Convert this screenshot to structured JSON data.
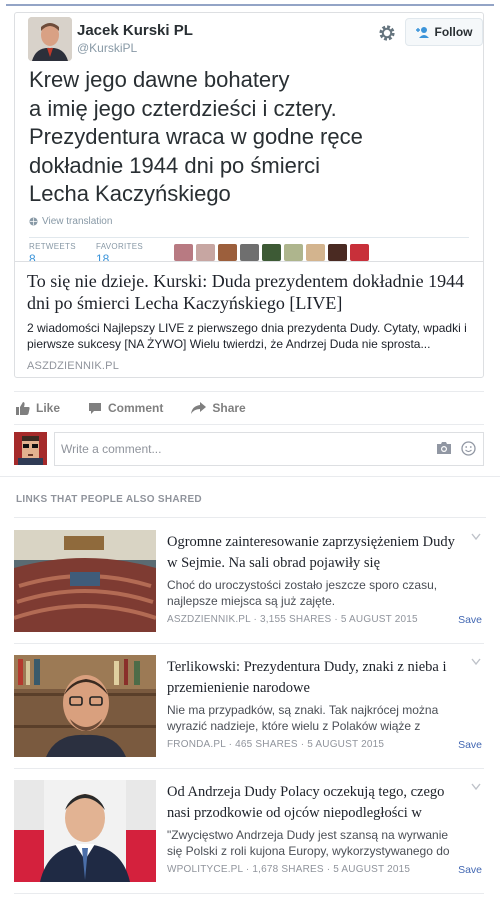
{
  "tweet": {
    "author": "Jacek Kurski PL",
    "handle": "@KurskiPL",
    "follow_label": "Follow",
    "text": "Krew jego dawne bohatery\na imię jego czterdzieści i cztery.\nPrezydentura wraca w godne ręce\ndokładnie 1944 dni po śmierci\nLecha Kaczyńskiego",
    "view_translation": "View translation",
    "retweets_label": "RETWEETS",
    "retweets_value": "8",
    "favorites_label": "FAVORITES",
    "favorites_value": "18"
  },
  "link_preview": {
    "title": "To się nie dzieje. Kurski: Duda prezydentem dokładnie 1944 dni po śmierci Lecha Kaczyńskiego [LIVE]",
    "description": "2 wiadomości Najlepszy LIVE z pierwszego dnia prezydenta Dudy. Cytaty, wpadki i pierwsze sukcesy [NA ŻYWO] Wielu twierdzi, że Andrzej Duda nie sprosta...",
    "domain": "ASZDZIENNIK.PL"
  },
  "actions": {
    "like": "Like",
    "comment": "Comment",
    "share": "Share"
  },
  "comment_box": {
    "placeholder": "Write a comment..."
  },
  "related": {
    "heading": "LINKS THAT PEOPLE ALSO SHARED",
    "items": [
      {
        "title": "Ogromne zainteresowanie zaprzysiężeniem Dudy w Sejmie. Na sali obrad pojawiły się",
        "description": "Choć do uroczystości zostało jeszcze sporo czasu, najlepsze miejsca są już zajęte.",
        "meta": "ASZDZIENNIK.PL · 3,155 SHARES · 5 AUGUST 2015",
        "save": "Save"
      },
      {
        "title": "Terlikowski: Prezydentura Dudy, znaki z nieba i przemienienie narodowe",
        "description": "Nie ma przypadków, są znaki. Tak najkrócej można wyrazić nadzieje, które wielu z Polaków wiąże z",
        "meta": "FRONDA.PL · 465 SHARES · 5 AUGUST 2015",
        "save": "Save"
      },
      {
        "title": "Od Andrzeja Dudy Polacy oczekują tego, czego nasi przodkowie od ojców niepodległości w",
        "description": "\"Zwycięstwo Andrzeja Dudy jest szansą na wyrwanie się Polski z roli kujona Europy, wykorzystywanego do",
        "meta": "WPOLITYCE.PL · 1,678 SHARES · 5 AUGUST 2015",
        "save": "Save"
      }
    ]
  },
  "colors": {
    "link_blue": "#4267b2",
    "twitter_blue": "#3b94d9",
    "muted": "#90949c"
  }
}
